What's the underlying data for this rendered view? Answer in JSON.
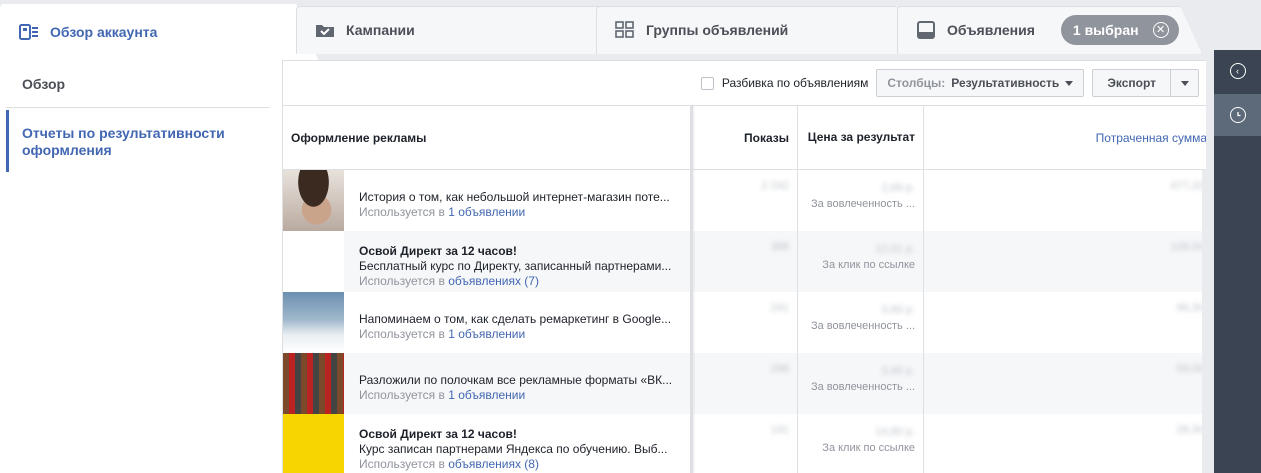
{
  "tabs": [
    {
      "label": "Обзор аккаунта",
      "icon": "account-overview-icon"
    },
    {
      "label": "Кампании",
      "icon": "folder-check-icon"
    },
    {
      "label": "Группы объявлений",
      "icon": "grid-icon"
    },
    {
      "label": "Объявления",
      "icon": "ad-icon"
    }
  ],
  "selected_badge": "1 выбран",
  "nav": {
    "overview": "Обзор",
    "reports": "Отчеты по результативности оформления"
  },
  "toolbar": {
    "breakdown_label": "Разбивка по объявлениям",
    "columns_prefix": "Столбцы:",
    "columns_value": "Результативность",
    "export_label": "Экспорт"
  },
  "table": {
    "headers": {
      "creative": "Оформление рекламы",
      "shows": "Показы",
      "price": "Цена за результат",
      "spent": "Потраченная сумма"
    },
    "rows": [
      {
        "title": "",
        "body": "История о том, как небольшой интернет-магазин поте...",
        "used_prefix": "Используется в",
        "used_link": "1 объявлении",
        "shows": "2 242",
        "price": "2,69 р.",
        "price_sub": "За вовлеченность ...",
        "spent": "477,20"
      },
      {
        "title": "Освой Директ за 12 часов!",
        "body": "Бесплатный курс по Директу, записанный партнерами...",
        "used_prefix": "Используется в",
        "used_link": "объявлениях (7)",
        "shows": "388",
        "price": "12,01 р.",
        "price_sub": "За клик по ссылке",
        "spent": "108,00"
      },
      {
        "title": "",
        "body": "Напоминаем о том, как сделать ремаркетинг в Google...",
        "used_prefix": "Используется в",
        "used_link": "1 объявлении",
        "shows": "241",
        "price": "3,89 р.",
        "price_sub": "За вовлеченность ...",
        "spent": "96,30"
      },
      {
        "title": "",
        "body": "Разложили по полочкам все рекламные форматы «ВК...",
        "used_prefix": "Используется в",
        "used_link": "1 объявлении",
        "shows": "298",
        "price": "3,45 р.",
        "price_sub": "За вовлеченность ...",
        "spent": "59,00"
      },
      {
        "title": "Освой Директ за 12 часов!",
        "body": "Курс записан партнерами Яндекса по обучению. Выб...",
        "used_prefix": "Используется в",
        "used_link": "объявлениях (8)",
        "shows": "141",
        "price": "14,80 р.",
        "price_sub": "За клик по ссылке",
        "spent": "28,30"
      }
    ]
  },
  "colors": {
    "accent": "#4267b2",
    "sidebar_dark": "#3a4452",
    "badge": "#90949c"
  }
}
